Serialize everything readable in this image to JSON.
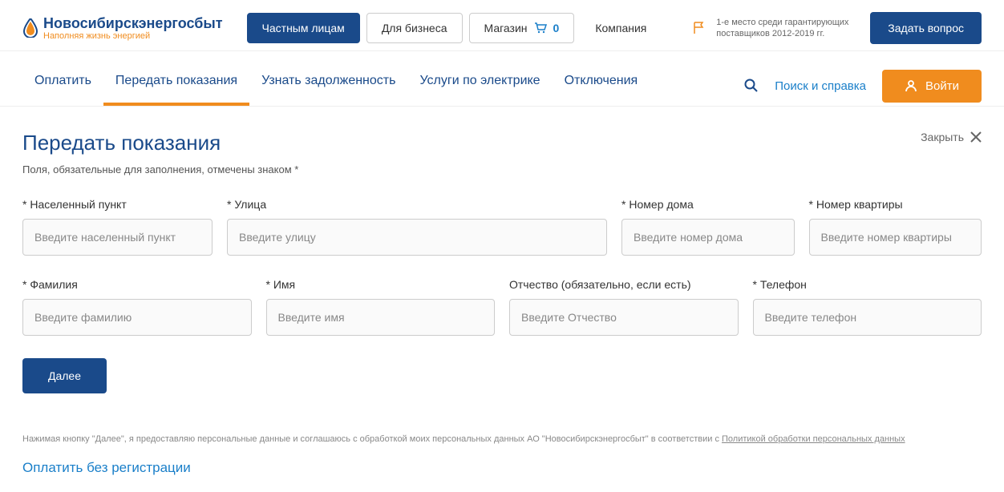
{
  "header": {
    "logo_main": "Новосибирскэнергосбыт",
    "logo_sub": "Наполняя жизнь энергией",
    "tabs": {
      "private": "Частным лицам",
      "business": "Для бизнеса",
      "shop": "Магазин",
      "cart_count": "0",
      "company": "Компания"
    },
    "award": "1-е место среди гарантирующих поставщиков 2012-2019 гг.",
    "ask_btn": "Задать вопрос"
  },
  "nav": {
    "pay": "Оплатить",
    "submit": "Передать показания",
    "debt": "Узнать задолженность",
    "services": "Услуги по электрике",
    "outages": "Отключения",
    "search": "Поиск и справка",
    "login": "Войти"
  },
  "page": {
    "title": "Передать показания",
    "close": "Закрыть",
    "required_note": "Поля, обязательные для заполнения, отмечены знаком *",
    "next_btn": "Далее",
    "disclaimer_1": "Нажимая кнопку \"Далее\", я предоставляю персональные данные и соглашаюсь с обработкой моих персональных данных АО \"Новосибирскэнергосбыт\" в соответствии с ",
    "disclaimer_link": "Политикой обработки персональных данных",
    "bottom_link": "Оплатить без регистрации"
  },
  "form": {
    "city": {
      "label": "* Населенный пункт",
      "ph": "Введите населенный пункт"
    },
    "street": {
      "label": "* Улица",
      "ph": "Введите улицу"
    },
    "house": {
      "label": "* Номер дома",
      "ph": "Введите номер дома"
    },
    "apt": {
      "label": "* Номер квартиры",
      "ph": "Введите номер квартиры"
    },
    "lastname": {
      "label": "* Фамилия",
      "ph": "Введите фамилию"
    },
    "firstname": {
      "label": "* Имя",
      "ph": "Введите имя"
    },
    "patronymic": {
      "label": "Отчество (обязательно, если есть)",
      "ph": "Введите Отчество"
    },
    "phone": {
      "label": "* Телефон",
      "ph": "Введите телефон"
    }
  }
}
